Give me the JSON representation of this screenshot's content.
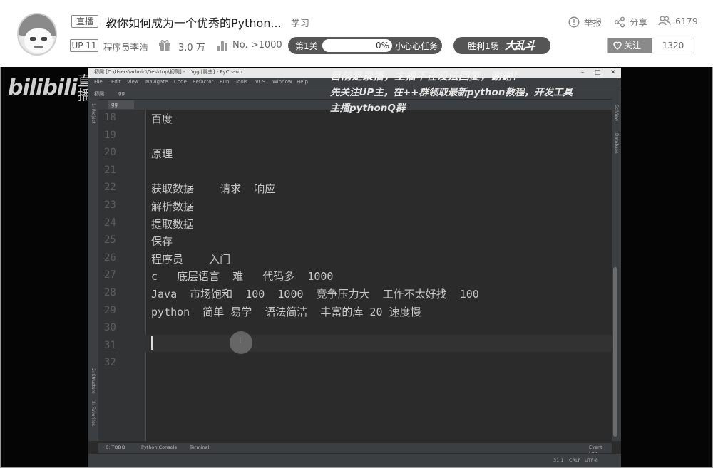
{
  "header": {
    "live_tag": "直播",
    "title": "教你如何成为一个优秀的Python...",
    "area": "学习",
    "up_tag": "UP 11",
    "streamer": "程序员李浩",
    "popularity": "3.0 万",
    "rank": "No. >1000",
    "level": {
      "label": "第1关",
      "percent_text": "0%",
      "progress": 0,
      "task": "小心心任务"
    },
    "battle": {
      "label": "胜利1场",
      "brand": "大乱斗"
    },
    "report_label": "举报",
    "share_label": "分享",
    "fans_count": "6179",
    "follow_label": "关注",
    "follow_count": "1320"
  },
  "player": {
    "logo": "bilibili",
    "live_glyph": "直\n播",
    "overlay": {
      "line1": "目前是录播，主播不在没法回复，谢谢！",
      "line2": "先关注UP主，在++群领取最新python教程，开发工具",
      "line3": "主播pythonQ群"
    }
  },
  "ide": {
    "window_title": "初爬 [C:\\Users\\admin\\Desktop\\初爬] - ...\\gg [爬虫] - PyCharm",
    "menu": [
      "File",
      "Edit",
      "View",
      "Navigate",
      "Code",
      "Refactor",
      "Run",
      "Tools",
      "VCS",
      "Window",
      "Help"
    ],
    "nav_project": "初爬",
    "nav_file": "gg",
    "tab": "gg",
    "left_tools": [
      "1: Project",
      "2: Structure",
      "2: Favorites"
    ],
    "right_tools": [
      "SciView",
      "Database"
    ],
    "lines": [
      {
        "num": "18",
        "text": "百度"
      },
      {
        "num": "19",
        "text": ""
      },
      {
        "num": "20",
        "text": "原理"
      },
      {
        "num": "21",
        "text": ""
      },
      {
        "num": "22",
        "text": "获取数据    请求  响应"
      },
      {
        "num": "23",
        "text": "解析数据"
      },
      {
        "num": "24",
        "text": "提取数据"
      },
      {
        "num": "25",
        "text": "保存"
      },
      {
        "num": "26",
        "text": "程序员    入门"
      },
      {
        "num": "27",
        "text": "c   底层语言  难   代码多  1000"
      },
      {
        "num": "28",
        "text": "Java  市场饱和  100  1000  竞争压力大  工作不太好找  100"
      },
      {
        "num": "29",
        "text": "python  简单 易学  语法简洁  丰富的库 20 速度慢"
      },
      {
        "num": "30",
        "text": ""
      },
      {
        "num": "31",
        "text": ""
      },
      {
        "num": "32",
        "text": ""
      }
    ],
    "bottom_tools": [
      "6: TODO",
      "Python Console",
      "Terminal",
      "Event Log"
    ],
    "status": {
      "position": "31:1",
      "line_sep": "CRLF",
      "encoding": "UTF-8"
    }
  }
}
